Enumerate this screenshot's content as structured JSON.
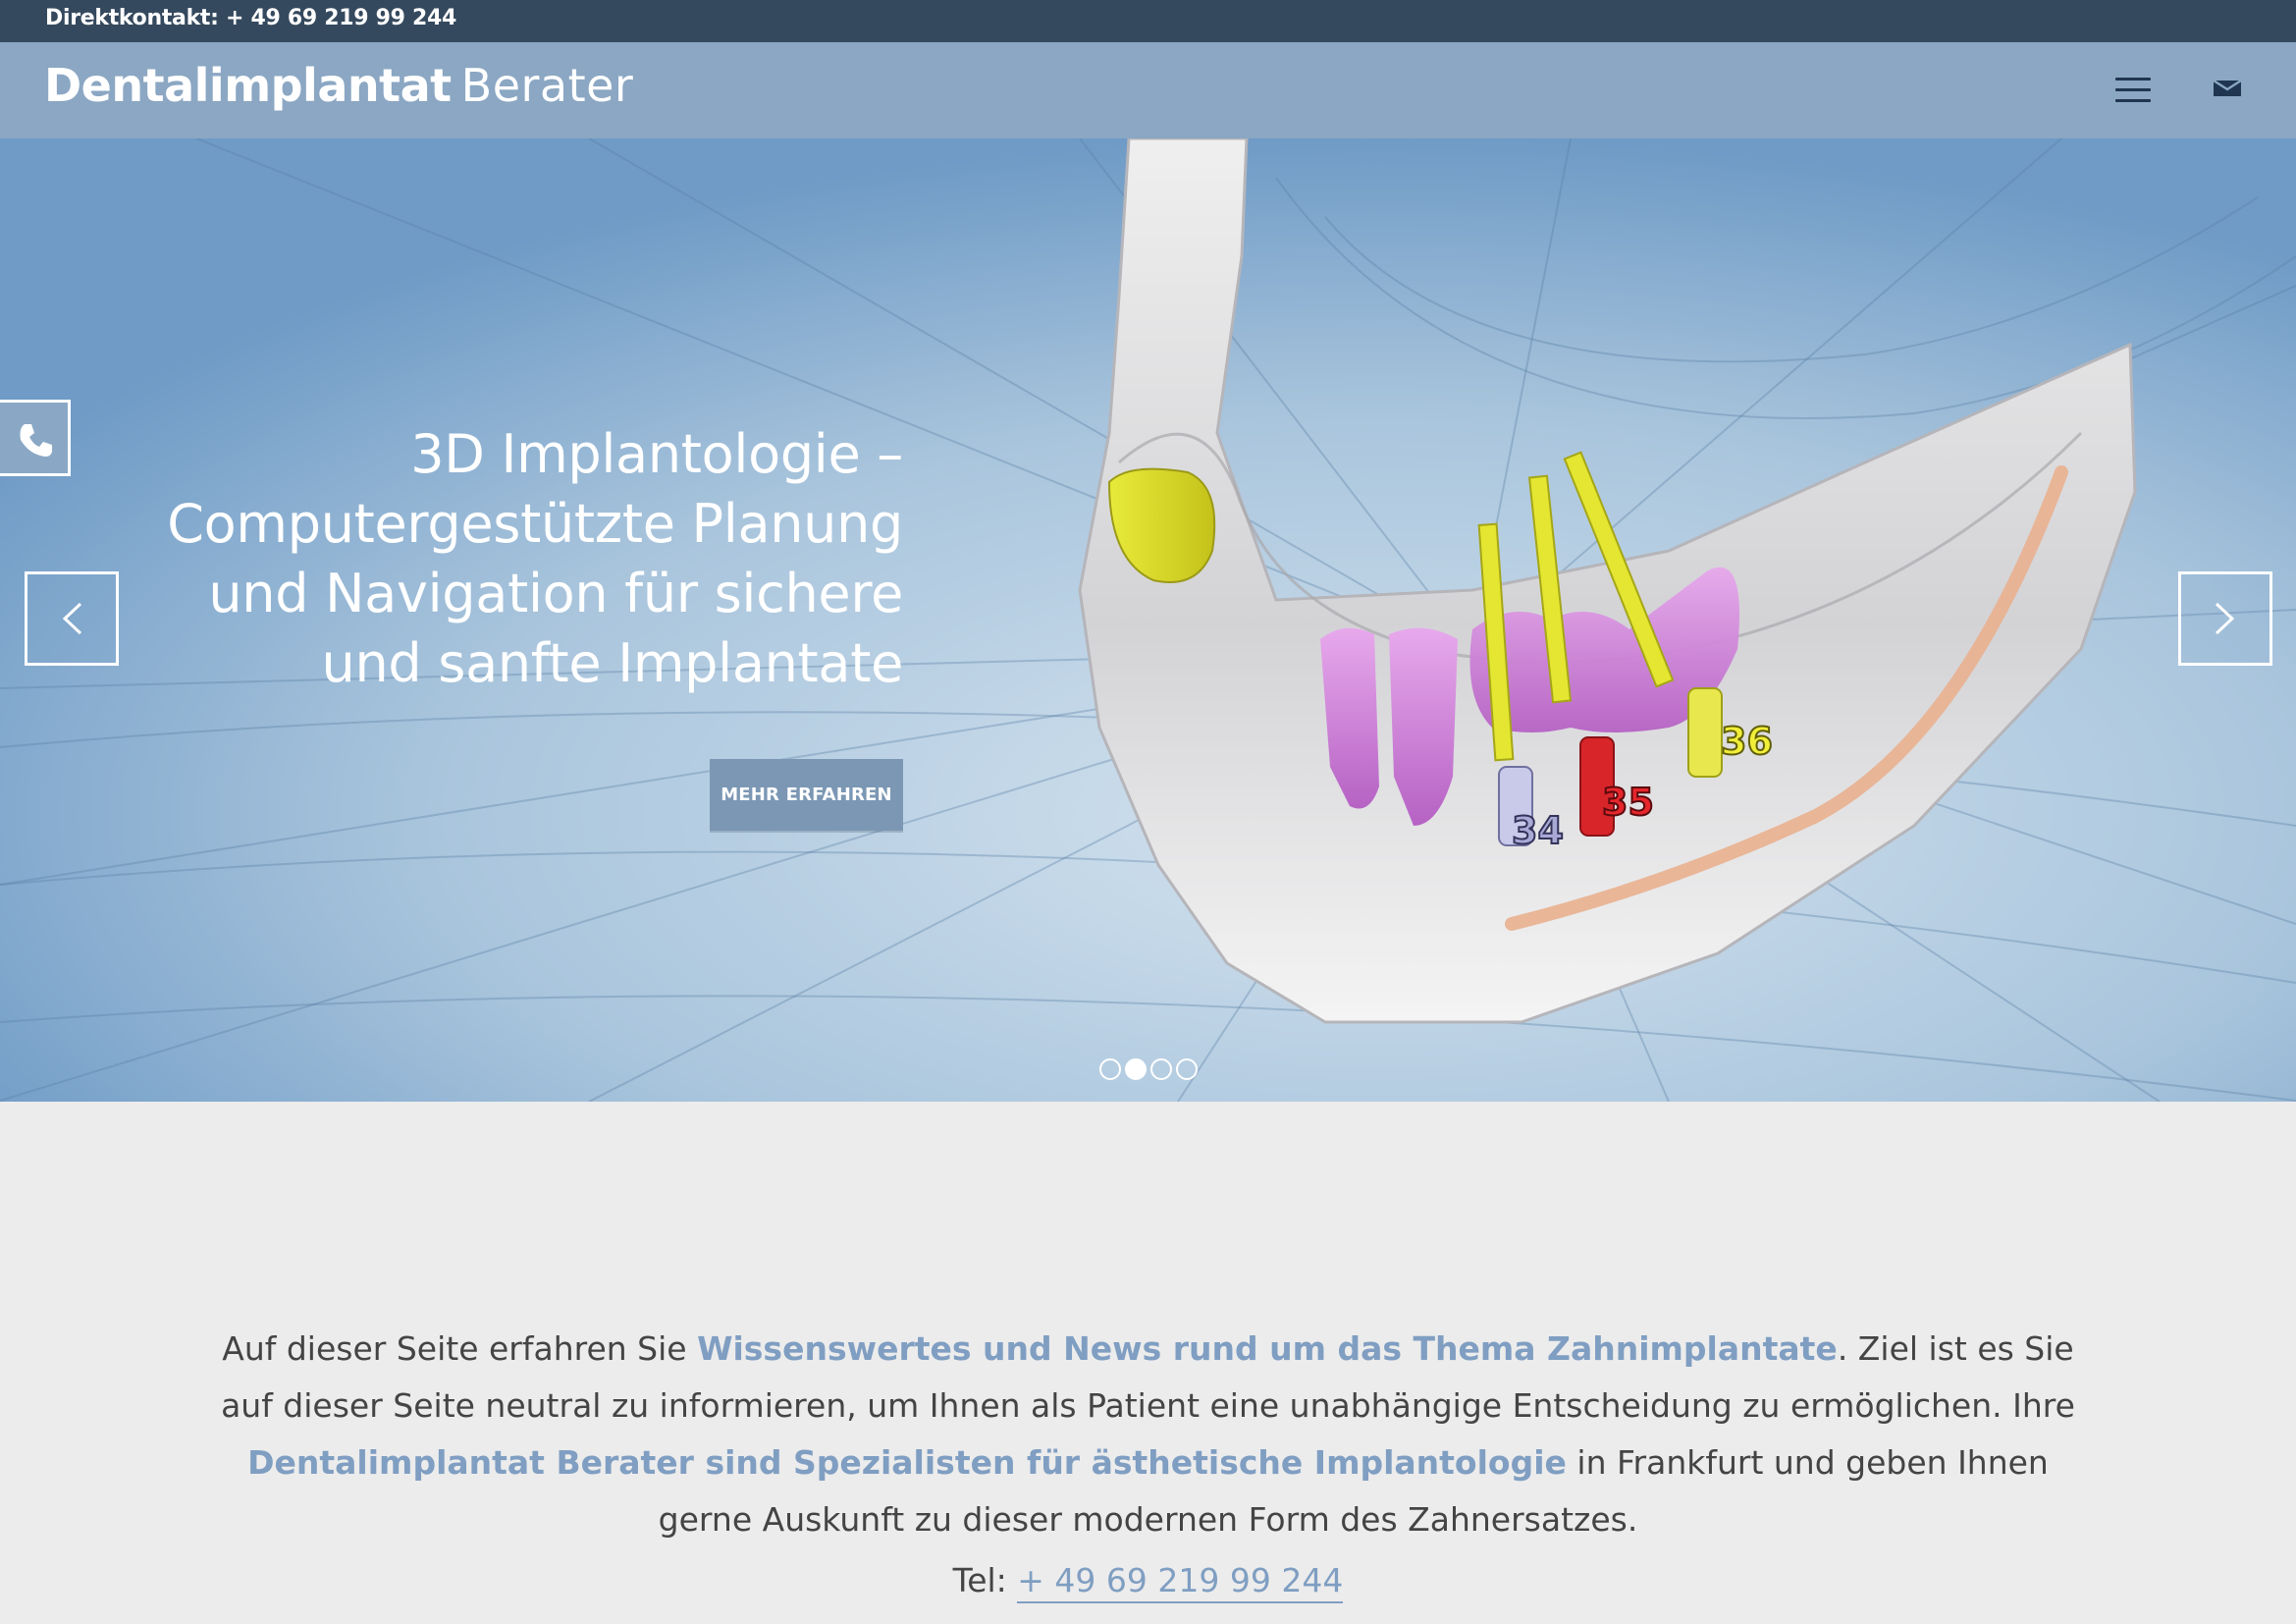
{
  "topbar": {
    "contact": "Direktkontakt: + 49 69 219 99 244"
  },
  "header": {
    "logo_strong": "Dentalimplantat",
    "logo_light": "Berater",
    "menu_icon": "hamburger-menu-icon",
    "mail_icon": "envelope-icon"
  },
  "hero": {
    "title_lines": [
      "3D Implantologie –",
      "Computergestützte Planung",
      "und Navigation für sichere",
      "und sanfte Implantate"
    ],
    "button_label": "MEHR ERFAHREN",
    "implant_labels": [
      "34",
      "35",
      "36"
    ],
    "prev_icon": "chevron-left-icon",
    "next_icon": "chevron-right-icon",
    "phone_icon": "phone-icon",
    "slides_total": 4,
    "active_slide": 2
  },
  "intro": {
    "p1_a": "Auf dieser Seite erfahren Sie ",
    "p1_link": "Wissenswertes und News rund um das Thema Zahnimplantate",
    "p1_b": ". Ziel ist es Sie auf dieser Seite neutral zu informieren, um Ihnen als Patient eine unabhängige Entscheidung  zu ermöglichen. Ihre ",
    "p1_link2": "Dentalimplantat Berater sind Spezialisten für ästhetische Implantologie",
    "p1_c": " in Frankfurt und geben Ihnen gerne Auskunft zu dieser modernen Form des Zahnersatzes.",
    "tel_label": "Tel: ",
    "tel_number": "+ 49 69 219 99 244"
  },
  "colors": {
    "topbar": "#35495e",
    "header": "#8ba7c3",
    "accent": "#7f9ec2",
    "button": "#7b97b4",
    "page_bg": "#ececec"
  }
}
